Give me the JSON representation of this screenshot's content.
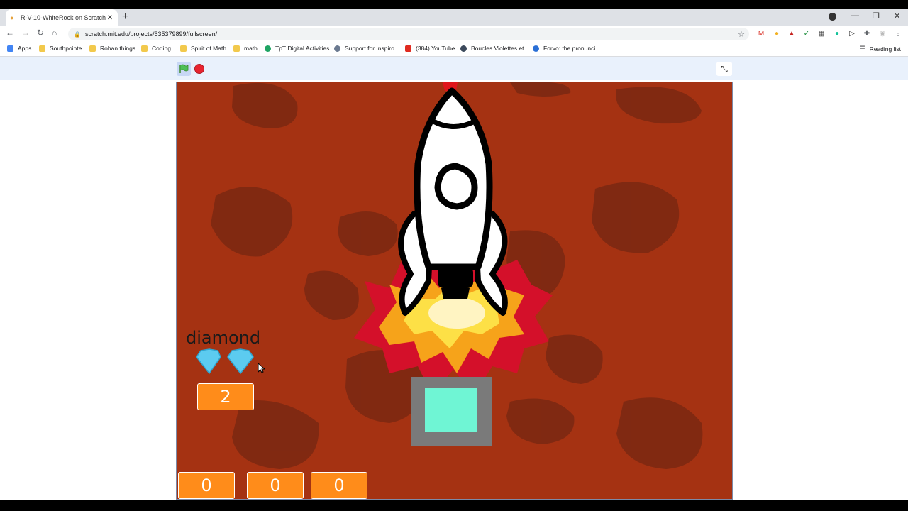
{
  "browser": {
    "tab_title": "R-V-10-WhiteRock on Scratch",
    "url": "scratch.mit.edu/projects/535379899/fullscreen/",
    "bookmarks": [
      {
        "label": "Apps",
        "color": "#4285f4"
      },
      {
        "label": "Southpointe",
        "color": "#f2c94c"
      },
      {
        "label": "Rohan things",
        "color": "#f2c94c"
      },
      {
        "label": "Coding",
        "color": "#f2c94c"
      },
      {
        "label": "Spirit of Math",
        "color": "#f2c94c"
      },
      {
        "label": "math",
        "color": "#f2c94c"
      },
      {
        "label": "TpT Digital Activities",
        "color": "#1fa463"
      },
      {
        "label": "Support for Inspiro...",
        "color": "#6b7a90"
      },
      {
        "label": "(384) YouTube",
        "color": "#e02b20"
      },
      {
        "label": "Boucles Violettes et...",
        "color": "#3c4a5c"
      },
      {
        "label": "Forvo: the pronunci...",
        "color": "#2a6fd6"
      }
    ],
    "reading_list": "Reading list"
  },
  "scratch": {
    "green_flag_icon": "green-flag-icon",
    "stop_icon": "stop-icon",
    "exit_fullscreen_icon": "exit-fullscreen-icon"
  },
  "stage": {
    "background_color": "#a53212",
    "crater_color": "#7a2812",
    "variable_label": "diamond",
    "diamond_count": "2",
    "bottom_counters": [
      "0",
      "0",
      "0"
    ],
    "counter_color": "#ff8c1a",
    "diamond_color": "#5ccbf0"
  }
}
